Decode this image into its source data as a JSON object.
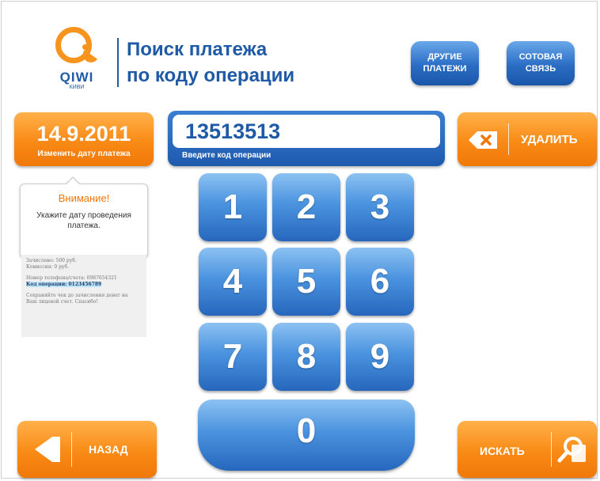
{
  "brand": {
    "name": "QIWI",
    "sub": "КИВИ"
  },
  "header": {
    "title_line1": "Поиск платежа",
    "title_line2": "по коду операции",
    "other_payments": "ДРУГИЕ ПЛАТЕЖИ",
    "mobile": "СОТОВАЯ СВЯЗЬ"
  },
  "date_panel": {
    "date": "14.9.2011",
    "change_label": "Изменить дату платежа"
  },
  "warning": {
    "title": "Внимание!",
    "text": "Укажите дату проведения платежа."
  },
  "receipt": {
    "line1": "Зачислено: 500 руб.",
    "line2": "Комиссия: 0 руб.",
    "line3": "Номер телефона/счета: 0987654321",
    "line4": "Код операции: 0123456789",
    "line5": "Сохраняйте чек до зачисления денег на",
    "line6": "Ваш лицевой счет. Спасибо!"
  },
  "code_input": {
    "value": "13513513",
    "hint": "Введите код операции"
  },
  "delete_label": "УДАЛИТЬ",
  "keypad": {
    "k1": "1",
    "k2": "2",
    "k3": "3",
    "k4": "4",
    "k5": "5",
    "k6": "6",
    "k7": "7",
    "k8": "8",
    "k9": "9",
    "k0": "0"
  },
  "nav": {
    "back": "НАЗАД",
    "search": "ИСКАТЬ"
  },
  "colors": {
    "accent_orange": "#f98a16",
    "accent_blue": "#1f5aa6"
  }
}
